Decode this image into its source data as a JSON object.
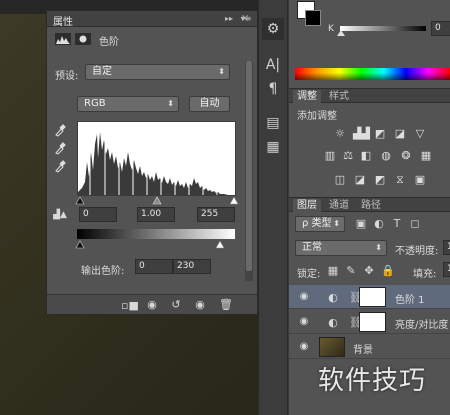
{
  "properties_panel": {
    "tab_title": "属性",
    "header_controls": [
      "▸▸",
      "▾≡"
    ],
    "close_glyph": "×",
    "adjustment_name": "色阶",
    "preset_label": "预设:",
    "preset_value": "自定",
    "channel_value": "RGB",
    "auto_button": "自动",
    "input_black": "0",
    "input_gamma": "1.00",
    "input_white": "255",
    "output_label": "输出色阶:",
    "output_black": "0",
    "output_white": "230"
  },
  "color_panel": {
    "k_label": "K",
    "k_value": "0"
  },
  "adjustments_panel": {
    "tabs": [
      "调整",
      "样式"
    ],
    "add_label": "添加调整"
  },
  "layers_panel": {
    "tabs": [
      "图层",
      "通道",
      "路径"
    ],
    "filter_kind": "ρ 类型",
    "blend_mode": "正常",
    "opacity_label": "不透明度:",
    "opacity_value": "1",
    "lock_label": "锁定:",
    "fill_label": "填充:",
    "fill_value": "1",
    "layers": [
      {
        "name": "色阶 1",
        "selected": true
      },
      {
        "name": "亮度/对比度",
        "selected": false
      },
      {
        "name": "背景",
        "selected": false
      }
    ]
  },
  "watermark": "软件技巧",
  "colors": {
    "panel": "#535353",
    "header": "#424242",
    "selected_row": "#5f6a7d"
  }
}
